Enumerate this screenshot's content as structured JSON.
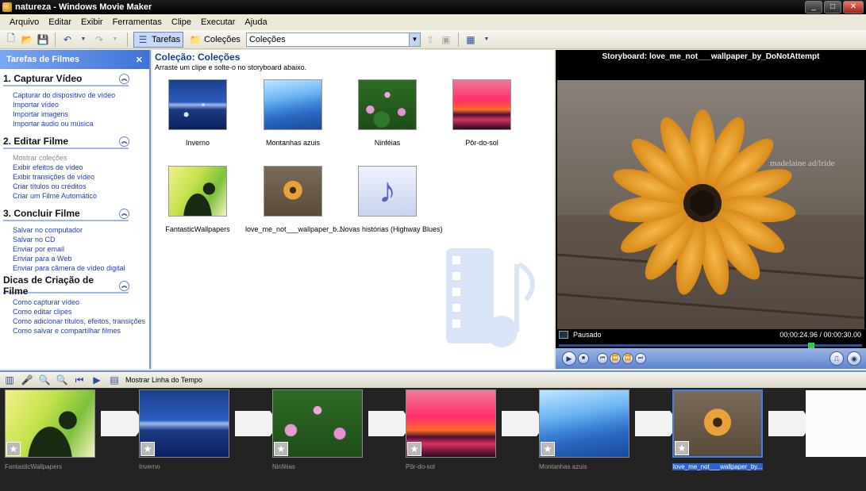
{
  "window": {
    "title": "natureza - Windows Movie Maker"
  },
  "menu": [
    "Arquivo",
    "Editar",
    "Exibir",
    "Ferramentas",
    "Clipe",
    "Executar",
    "Ajuda"
  ],
  "toolbar": {
    "tasks_label": "Tarefas",
    "collections_label": "Coleções",
    "collection_select": "Coleções"
  },
  "taskpane": {
    "header": "Tarefas de Filmes",
    "sections": [
      {
        "title": "1. Capturar Vídeo",
        "links": [
          "Capturar do dispositivo de vídeo",
          "Importar vídeo",
          "Importar imagens",
          "Importar áudio ou música"
        ]
      },
      {
        "title": "2. Editar Filme",
        "links": [
          "Mostrar coleções",
          "Exibir efeitos de vídeo",
          "Exibir transições de vídeo",
          "Criar títulos ou créditos",
          "Criar um Filme Automático"
        ]
      },
      {
        "title": "3. Concluir Filme",
        "links": [
          "Salvar no computador",
          "Salvar no CD",
          "Enviar por email",
          "Enviar para a Web",
          "Enviar para câmera de vídeo digital"
        ]
      },
      {
        "title": "Dicas de Criação de Filme",
        "links": [
          "Como capturar vídeo",
          "Como editar clipes",
          "Como adicionar títulos, efeitos, transições",
          "Como salvar e compartilhar filmes"
        ]
      }
    ]
  },
  "collection": {
    "title": "Coleção: Coleções",
    "subtitle": "Arraste um clipe e solte-o no storyboard abaixo.",
    "clips": [
      "Inverno",
      "Montanhas azuis",
      "Ninféias",
      "Pôr-do-sol",
      "FantasticWallpapers",
      "love_me_not___wallpaper_b...",
      "Novas histórias (Highway Blues)"
    ]
  },
  "preview": {
    "title": "Storyboard: love_me_not___wallpaper_by_DoNotAttempt",
    "status": "Pausado",
    "time": "00:00:24.96 / 00:00:30.00",
    "watermark_text": "madelaine ad/lride",
    "progress": 0.832
  },
  "storyboard_toolbar": {
    "timeline_label": "Mostrar Linha do Tempo"
  },
  "storyboard": [
    "FantasticWallpapers",
    "Inverno",
    "Ninféias",
    "Pôr-do-sol",
    "Montanhas azuis",
    "love_me_not___wallpaper_by..."
  ]
}
